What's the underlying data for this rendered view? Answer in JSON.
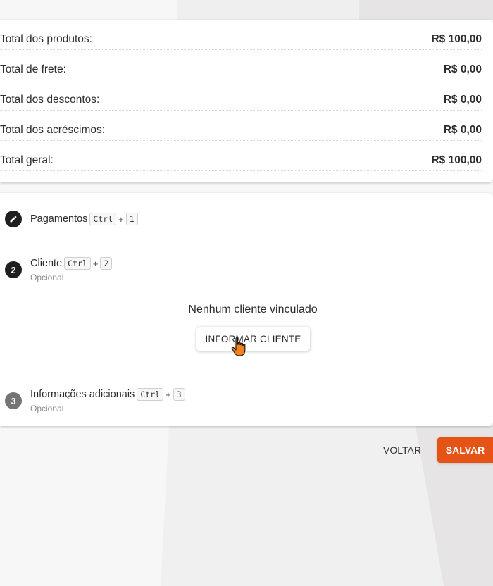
{
  "totals": {
    "rows": [
      {
        "label": "Total dos produtos:",
        "value": "R$ 100,00"
      },
      {
        "label": "Total de frete:",
        "value": "R$ 0,00"
      },
      {
        "label": "Total dos descontos:",
        "value": "R$ 0,00"
      },
      {
        "label": "Total dos acréscimos:",
        "value": "R$ 0,00"
      },
      {
        "label": "Total geral:",
        "value": "R$ 100,00"
      }
    ]
  },
  "steps": [
    {
      "icon": "pencil-icon",
      "title": "Pagamentos",
      "shortcut_key": "Ctrl",
      "shortcut_plus": "+",
      "shortcut_num": "1"
    },
    {
      "number": "2",
      "title": "Cliente",
      "shortcut_key": "Ctrl",
      "shortcut_plus": "+",
      "shortcut_num": "2",
      "optional": "Opcional"
    },
    {
      "number": "3",
      "title": "Informações adicionais",
      "shortcut_key": "Ctrl",
      "shortcut_plus": "+",
      "shortcut_num": "3",
      "optional": "Opcional"
    }
  ],
  "client": {
    "empty_message": "Nenhum cliente vinculado",
    "button_label": "INFORMAR CLIENTE"
  },
  "footer": {
    "back_label": "VOLTAR",
    "save_label": "SALVAR"
  },
  "colors": {
    "accent": "#e65317",
    "step_active": "#1f1f1f",
    "step_inactive": "#757575"
  }
}
